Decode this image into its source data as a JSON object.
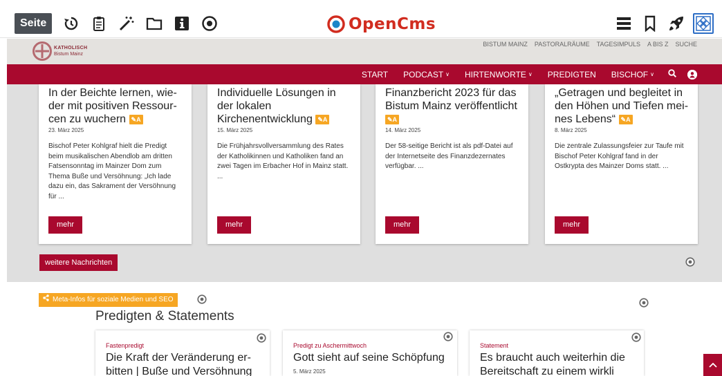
{
  "toolbar": {
    "seite_label": "Seite",
    "left_icons": [
      "history-icon",
      "clipboard-icon",
      "magic-wand-icon",
      "folder-icon",
      "info-icon",
      "target-icon"
    ],
    "logo_text": "OpenCms",
    "right_icons": [
      "hamburger-menu-icon",
      "bookmark-icon",
      "rocket-icon",
      "apps-tile-icon"
    ]
  },
  "site": {
    "brand": {
      "line1": "KATHOLISCH",
      "line2": "Bistum Mainz"
    },
    "meta_nav": [
      "BISTUM MAINZ",
      "PASTORALRÄUME",
      "TAGESIMPULS",
      "A BIS Z",
      "SUCHE"
    ],
    "main_nav": [
      {
        "label": "START",
        "caret": false
      },
      {
        "label": "PODCAST",
        "caret": true
      },
      {
        "label": "HIRTENWORTE",
        "caret": true
      },
      {
        "label": "PREDIGTEN",
        "caret": false
      },
      {
        "label": "BISCHOF",
        "caret": true
      }
    ],
    "caret_glyph": "∨"
  },
  "news": {
    "cards": [
      {
        "title": "In der Beichte lernen, wie­der mit positiven Ressour­cen zu wuchern",
        "badge": "A",
        "date": "23. März 2025",
        "teaser": "Bischof Peter Kohlgraf hielt die Pre­digt beim musikalischen Abendlob am dritten Fatsensonntag im Main­zer Dom zum Thema Buße und Ver­söhnung: „Ich lade dazu ein, das Sa­krament der Versöhnung für ...",
        "button": "mehr"
      },
      {
        "title": "Individuelle Lösungen in der lokalen Kirchenentwick­lung",
        "badge": "A",
        "date": "15. März 2025",
        "teaser": "Die Frühjahrsvollversammlung des Rates der Katholikinnen und Katholi­ken fand an zwei Tagen im Erbacher Hof in Mainz statt. ...",
        "button": "mehr"
      },
      {
        "title": "Finanzbericht 2023 für das Bistum Mainz veröffentlicht",
        "badge": "A",
        "date": "14. März 2025",
        "teaser": "Der 58-seitige Bericht ist als pdf-Da­tei auf der Internetseite des Finanz­dezernates verfügbar. ...",
        "button": "mehr"
      },
      {
        "title": "„Getragen und begleitet in den Höhen und Tiefen mei­nes Lebens“",
        "badge": "A",
        "date": "8. März 2025",
        "teaser": "Die zentrale Zulassungsfeier zur Tau­fe mit Bischof Peter Kohlgraf fand in der Ostkrypta des Mainzer Doms statt. ...",
        "button": "mehr"
      }
    ],
    "more_button": "weitere Nachrichten"
  },
  "lower": {
    "meta_infos_label": "Meta-Infos für soziale Medien und SEO",
    "section_title": "Predigten & Statements",
    "cards": [
      {
        "kicker": "Fastenpredigt",
        "title": "Die Kraft der Veränderung er­bitten | Buße und Versöhnung",
        "date": ""
      },
      {
        "kicker": "Predigt zu Aschermittwoch",
        "title": "Gott sieht auf seine Schöpfung",
        "date": "5. März 2025"
      },
      {
        "kicker": "Statement",
        "title": "Es braucht auch weiterhin die Bereitschaft zu einem wirkli­",
        "date": ""
      }
    ]
  },
  "colors": {
    "brand_red": "#a9092e",
    "badge_orange": "#f6a623",
    "opencms_red": "#d12c1f",
    "toolbar_dark": "#4a4f55"
  }
}
